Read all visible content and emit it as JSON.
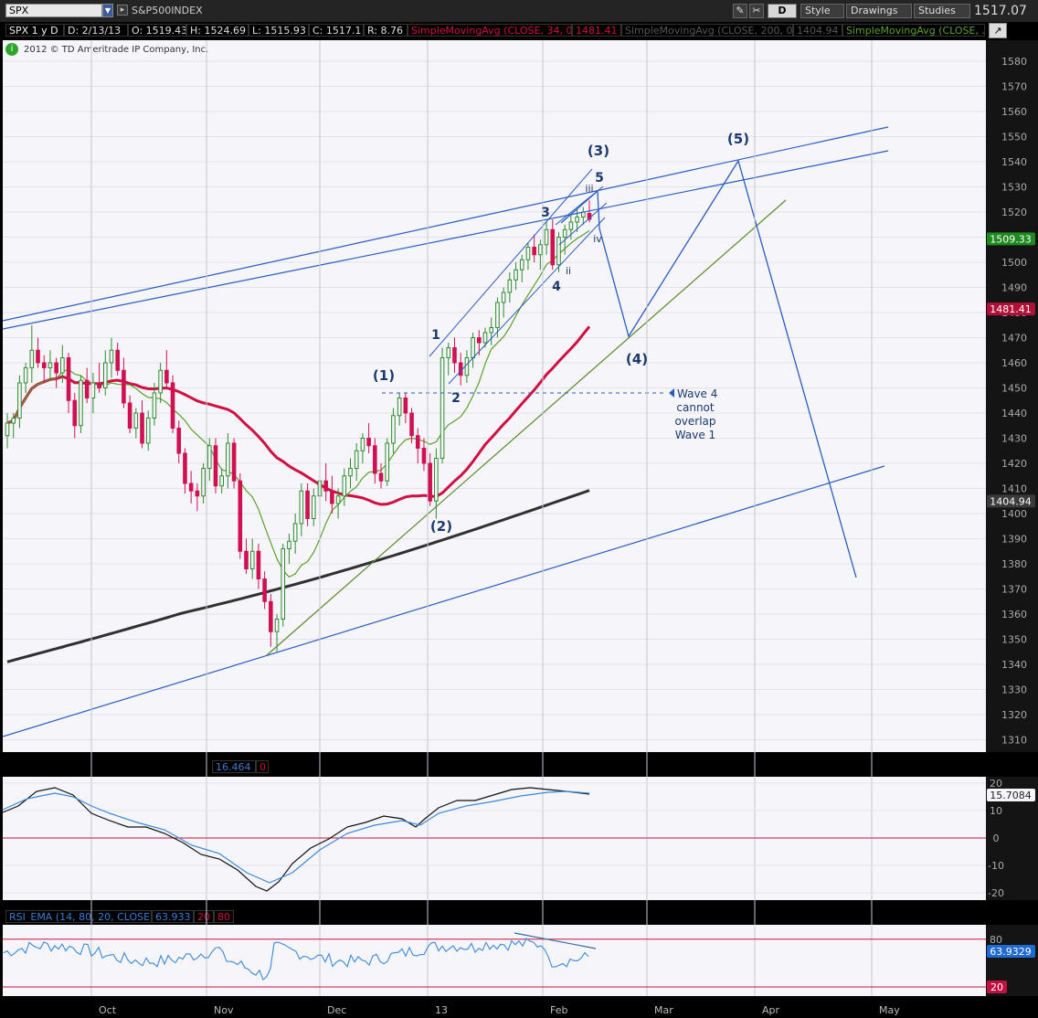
{
  "toolbar": {
    "symbol": "SPX",
    "instrument": "S&P500INDEX",
    "timeframe": "D",
    "style_label": "Style",
    "drawings_label": "Drawings",
    "studies_label": "Studies",
    "last_price": "1517.07"
  },
  "header": {
    "period": "SPX 1 y D",
    "date": "D: 2/13/13",
    "open": "O: 1519.43",
    "high": "H: 1524.69",
    "low": "L: 1515.93",
    "close": "C: 1517.1",
    "range": "R: 8.76",
    "sma34": "SimpleMovingAvg (CLOSE, 34, 0)",
    "sma34_val": "1481.41",
    "sma200": "SimpleMovingAvg (CLOSE, 200, 0)",
    "sma200_val": "1404.94",
    "sma_green": "SimpleMovingAvg (CLOSE, ..."
  },
  "copyright": "2012 © TD Ameritrade IP Company, Inc.",
  "colors": {
    "candle_up": "#2e8b2e",
    "candle_down": "#d01050",
    "sma34": "#d01040",
    "sma200": "#303030",
    "sma_green": "#5aa02a",
    "channel": "#2a5cc0",
    "trend_green": "#5a8a2a",
    "panel_bg": "#f5f5fa"
  },
  "main": {
    "y_ticks": [
      "1580",
      "1570",
      "1560",
      "1550",
      "1540",
      "1530",
      "1520",
      "1510",
      "1500",
      "1490",
      "1480",
      "1470",
      "1460",
      "1450",
      "1440",
      "1430",
      "1420",
      "1410",
      "1400",
      "1390",
      "1380",
      "1370",
      "1360",
      "1350",
      "1340",
      "1330",
      "1320",
      "1310"
    ],
    "price_tags": {
      "current": "1509.33",
      "sma34": "1481.41",
      "sma200": "1404.94"
    },
    "wave_labels": {
      "w1_primary": "(1)",
      "w2_primary": "(2)",
      "w3_primary": "(3)",
      "w4_primary": "(4)",
      "w5_primary": "(5)",
      "m1": "1",
      "m2": "2",
      "m3": "3",
      "m4": "4",
      "m5": "5",
      "sub_ii": "ii",
      "sub_iii": "iii",
      "sub_iv": "iv"
    },
    "note": [
      "Wave 4",
      "cannot",
      "overlap",
      "Wave 1"
    ]
  },
  "oscillator": {
    "header_value": "16.464",
    "header_zero": "0",
    "y_ticks": [
      "20",
      "10",
      "0",
      "-10",
      "-20"
    ],
    "price_tag": "15.7084"
  },
  "rsi": {
    "label": "RSI_EMA (14, 80, 20, CLOSE)",
    "value": "63.933",
    "lower": "20",
    "upper": "80",
    "y_ticks": [
      "80"
    ],
    "price_tag": "63.9329",
    "lower_tag": "20"
  },
  "x_axis": [
    "Oct",
    "Nov",
    "Dec",
    "13",
    "Feb",
    "Mar",
    "Apr",
    "May"
  ],
  "chart_data": {
    "type": "candlestick",
    "title": "SPX 1 y D",
    "ylim": [
      1305,
      1588
    ],
    "grid": true,
    "legend": "top",
    "candles": [
      [
        1431,
        1440,
        1426,
        1436
      ],
      [
        1436,
        1440,
        1430,
        1438
      ],
      [
        1438,
        1455,
        1434,
        1452
      ],
      [
        1452,
        1460,
        1448,
        1458
      ],
      [
        1458,
        1475,
        1452,
        1465
      ],
      [
        1465,
        1470,
        1458,
        1460
      ],
      [
        1460,
        1463,
        1452,
        1458
      ],
      [
        1458,
        1465,
        1453,
        1460
      ],
      [
        1460,
        1462,
        1450,
        1456
      ],
      [
        1456,
        1467,
        1452,
        1462
      ],
      [
        1462,
        1464,
        1440,
        1445
      ],
      [
        1445,
        1448,
        1430,
        1435
      ],
      [
        1435,
        1455,
        1432,
        1453
      ],
      [
        1453,
        1458,
        1444,
        1446
      ],
      [
        1446,
        1456,
        1440,
        1452
      ],
      [
        1452,
        1460,
        1448,
        1450
      ],
      [
        1450,
        1465,
        1447,
        1460
      ],
      [
        1460,
        1470,
        1454,
        1465
      ],
      [
        1465,
        1468,
        1455,
        1457
      ],
      [
        1457,
        1462,
        1442,
        1444
      ],
      [
        1444,
        1447,
        1432,
        1434
      ],
      [
        1434,
        1442,
        1430,
        1440
      ],
      [
        1440,
        1445,
        1426,
        1428
      ],
      [
        1428,
        1441,
        1425,
        1438
      ],
      [
        1438,
        1452,
        1435,
        1448
      ],
      [
        1448,
        1460,
        1444,
        1457
      ],
      [
        1457,
        1465,
        1450,
        1452
      ],
      [
        1452,
        1455,
        1432,
        1434
      ],
      [
        1434,
        1437,
        1420,
        1424
      ],
      [
        1424,
        1426,
        1408,
        1412
      ],
      [
        1412,
        1417,
        1404,
        1409
      ],
      [
        1409,
        1412,
        1401,
        1407
      ],
      [
        1407,
        1420,
        1404,
        1418
      ],
      [
        1418,
        1430,
        1413,
        1427
      ],
      [
        1427,
        1430,
        1408,
        1411
      ],
      [
        1411,
        1418,
        1408,
        1415
      ],
      [
        1415,
        1432,
        1410,
        1428
      ],
      [
        1428,
        1430,
        1410,
        1413
      ],
      [
        1413,
        1416,
        1382,
        1385
      ],
      [
        1385,
        1390,
        1376,
        1378
      ],
      [
        1378,
        1390,
        1374,
        1385
      ],
      [
        1385,
        1388,
        1370,
        1374
      ],
      [
        1374,
        1377,
        1362,
        1365
      ],
      [
        1365,
        1368,
        1347,
        1353
      ],
      [
        1353,
        1360,
        1345,
        1358
      ],
      [
        1358,
        1388,
        1355,
        1386
      ],
      [
        1386,
        1392,
        1380,
        1389
      ],
      [
        1389,
        1400,
        1384,
        1396
      ],
      [
        1396,
        1412,
        1391,
        1409
      ],
      [
        1409,
        1412,
        1395,
        1398
      ],
      [
        1398,
        1410,
        1395,
        1407
      ],
      [
        1407,
        1416,
        1400,
        1413
      ],
      [
        1413,
        1420,
        1405,
        1409
      ],
      [
        1409,
        1415,
        1400,
        1404
      ],
      [
        1404,
        1410,
        1398,
        1407
      ],
      [
        1407,
        1418,
        1403,
        1415
      ],
      [
        1415,
        1422,
        1410,
        1418
      ],
      [
        1418,
        1428,
        1413,
        1425
      ],
      [
        1425,
        1432,
        1420,
        1430
      ],
      [
        1430,
        1436,
        1424,
        1427
      ],
      [
        1427,
        1430,
        1412,
        1416
      ],
      [
        1416,
        1420,
        1410,
        1413
      ],
      [
        1413,
        1430,
        1411,
        1428
      ],
      [
        1428,
        1442,
        1424,
        1439
      ],
      [
        1439,
        1448,
        1435,
        1446
      ],
      [
        1446,
        1448,
        1436,
        1440
      ],
      [
        1440,
        1442,
        1428,
        1431
      ],
      [
        1431,
        1434,
        1420,
        1426
      ],
      [
        1426,
        1430,
        1417,
        1420
      ],
      [
        1420,
        1424,
        1403,
        1405
      ],
      [
        1405,
        1426,
        1398,
        1422
      ],
      [
        1422,
        1466,
        1420,
        1462
      ],
      [
        1462,
        1468,
        1455,
        1466
      ],
      [
        1466,
        1470,
        1456,
        1460
      ],
      [
        1460,
        1464,
        1451,
        1455
      ],
      [
        1455,
        1465,
        1452,
        1462
      ],
      [
        1462,
        1472,
        1458,
        1470
      ],
      [
        1470,
        1473,
        1463,
        1468
      ],
      [
        1468,
        1474,
        1466,
        1472
      ],
      [
        1472,
        1478,
        1467,
        1474
      ],
      [
        1474,
        1486,
        1470,
        1484
      ],
      [
        1484,
        1490,
        1478,
        1488
      ],
      [
        1488,
        1496,
        1484,
        1493
      ],
      [
        1493,
        1500,
        1489,
        1497
      ],
      [
        1497,
        1503,
        1492,
        1501
      ],
      [
        1501,
        1508,
        1497,
        1506
      ],
      [
        1506,
        1511,
        1500,
        1503
      ],
      [
        1503,
        1509,
        1497,
        1507
      ],
      [
        1507,
        1516,
        1503,
        1513
      ],
      [
        1513,
        1517,
        1497,
        1499
      ],
      [
        1499,
        1512,
        1496,
        1510
      ],
      [
        1510,
        1515,
        1503,
        1513
      ],
      [
        1513,
        1519,
        1509,
        1516
      ],
      [
        1516,
        1521,
        1512,
        1518
      ],
      [
        1518,
        1522,
        1515,
        1520
      ],
      [
        1519.43,
        1524.69,
        1515.93,
        1517.1
      ]
    ],
    "series": [
      {
        "name": "SimpleMovingAvg (CLOSE, 34, 0)",
        "last": 1481.41
      },
      {
        "name": "SimpleMovingAvg (CLOSE, 200, 0)",
        "last": 1404.94
      },
      {
        "name": "SimpleMovingAvg (CLOSE, ...",
        "last": 1509.33
      }
    ],
    "wave_projection": {
      "points": [
        [
          1524,
          1528
        ],
        [
          1470,
          1470
        ],
        [
          1540,
          1540
        ],
        [
          1373,
          1373
        ]
      ]
    },
    "oscillator_ylim": [
      -22,
      22
    ],
    "oscillator_last": 15.7084,
    "rsi_ylim": [
      15,
      95
    ],
    "rsi_last": 63.9329
  }
}
